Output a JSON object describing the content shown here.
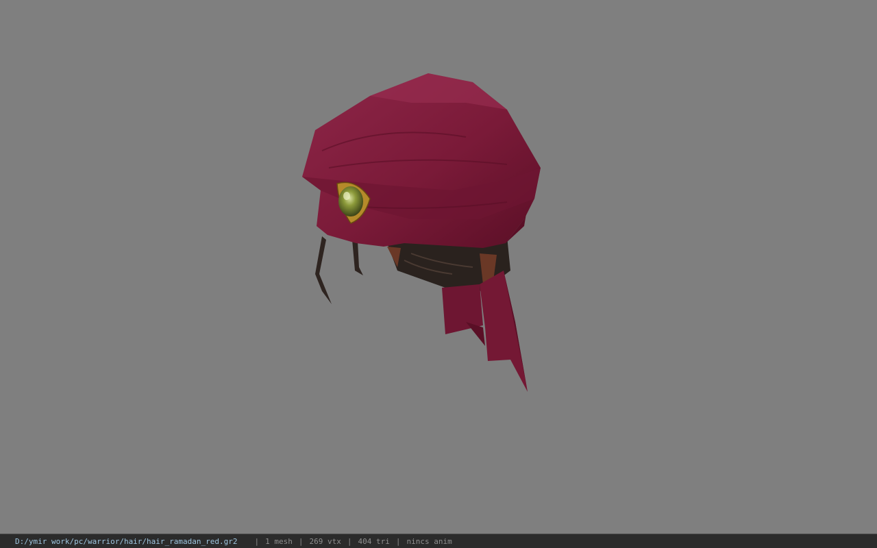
{
  "viewer": {
    "background_color": "#7f7f7f",
    "model_colors": {
      "cloth": "#7a1a38",
      "cloth_dark": "#5a0f26",
      "cloth_light": "#8e2648",
      "hair": "#2a221e",
      "skin": "#6a3826",
      "gem": "#8c9a3a",
      "gem_frame": "#b58a2a"
    }
  },
  "status_bar": {
    "file_path": "D:/ymir work/pc/warrior/hair/hair_ramadan_red.gr2",
    "separator": "|",
    "mesh_count": "1 mesh",
    "vertex_count": "269 vtx",
    "triangle_count": "404 tri",
    "anim_status": "nincs anim"
  }
}
